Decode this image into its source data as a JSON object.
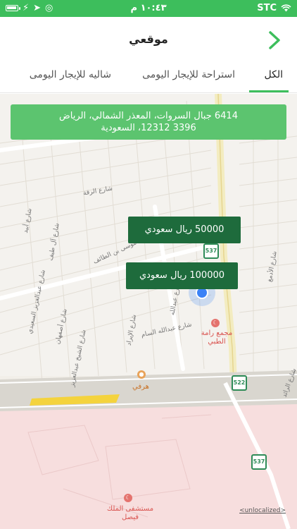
{
  "status_bar": {
    "time": "١٠:٤٣ م",
    "carrier": "STC",
    "battery_level": 0.85
  },
  "header": {
    "title": "موقعي"
  },
  "tabs": [
    {
      "label": "الكل",
      "active": true
    },
    {
      "label": "استراحة للإيجار اليومى",
      "active": false
    },
    {
      "label": "شاليه للإيجار اليومى",
      "active": false
    }
  ],
  "address": {
    "line1": "6414 جبال السروات، المعذر الشمالي، الرياض",
    "line2": "3396 12312، السعودية"
  },
  "price_markers": [
    {
      "label": "50000 ريال سعودي"
    },
    {
      "label": "100000 ريال سعودي"
    }
  ],
  "map": {
    "street_labels": [
      "شارع الرقة",
      "شارع أبيد",
      "شارع آل طيف",
      "شارع عبدالله السام",
      "شارع عبدالعزيز السعيدي",
      "شارع أصفهان",
      "شارع الشيخ عبدالعزيز",
      "شارع الأدمغ",
      "موسى بن الطائف",
      "شارع الإيراد",
      "شارع عبدالله",
      "شارع الرائد"
    ],
    "pois": {
      "clinic": "مجمع رامة الطبي",
      "hospital": "مستشفى الملك فيصل",
      "restaurant": "هرفي"
    },
    "road_shields": [
      "537",
      "522",
      "537"
    ],
    "attribution": "<unlocalized>"
  },
  "colors": {
    "brand_green": "#3dbe5c",
    "chip_dark_green": "#1e6b3c",
    "banner_green": "#5cc46f"
  }
}
